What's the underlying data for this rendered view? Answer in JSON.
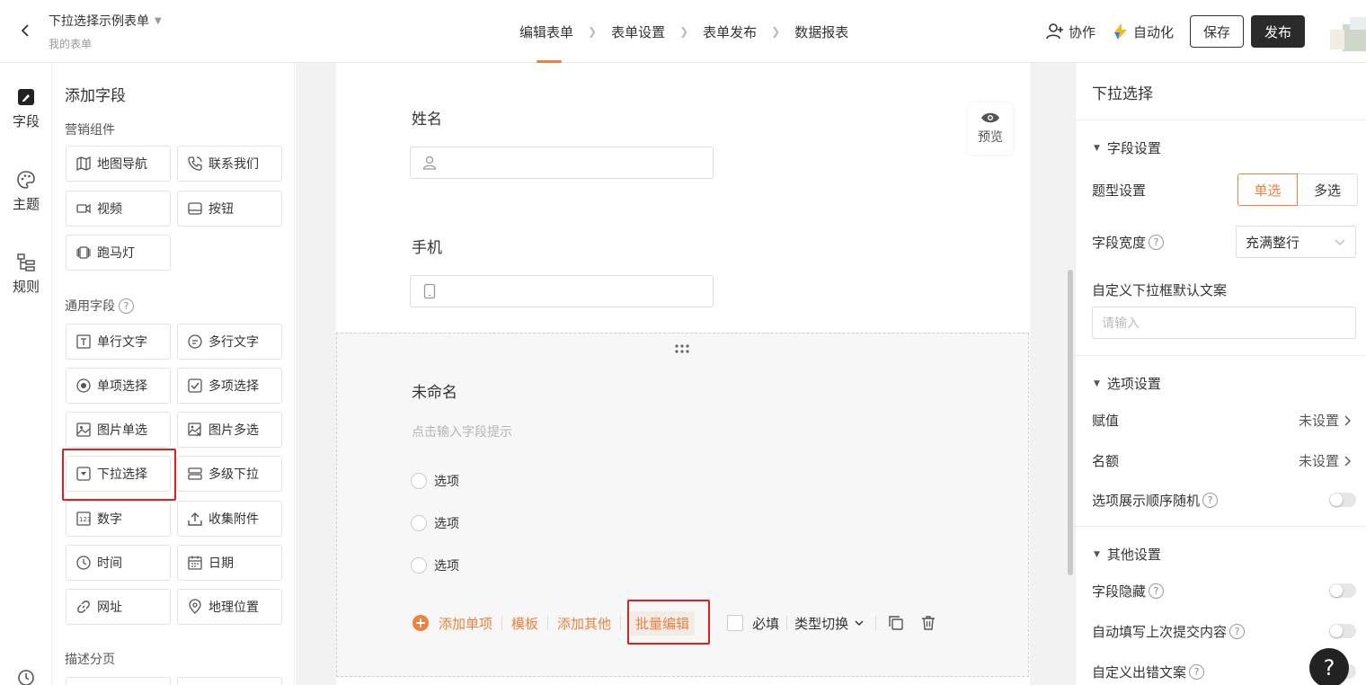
{
  "header": {
    "form_title": "下拉选择示例表单",
    "form_subtitle": "我的表单",
    "steps": [
      "编辑表单",
      "表单设置",
      "表单发布",
      "数据报表"
    ],
    "collab_label": "协作",
    "automation_label": "自动化",
    "save_label": "保存",
    "publish_label": "发布"
  },
  "rail": {
    "fields_label": "字段",
    "theme_label": "主题",
    "rules_label": "规则"
  },
  "palette": {
    "title": "添加字段",
    "marketing_group": "营销组件",
    "marketing_items": [
      "地图导航",
      "联系我们",
      "视频",
      "按钮",
      "跑马灯"
    ],
    "general_group": "通用字段",
    "general_items": [
      "单行文字",
      "多行文字",
      "单项选择",
      "多项选择",
      "图片单选",
      "图片多选",
      "下拉选择",
      "多级下拉",
      "数字",
      "收集附件",
      "时间",
      "日期",
      "网址",
      "地理位置"
    ],
    "desc_group": "描述分页"
  },
  "canvas": {
    "name_label": "姓名",
    "phone_label": "手机",
    "preview_label": "预览",
    "field_label": "未命名",
    "field_hint": "点击输入字段提示",
    "options": [
      "选项",
      "选项",
      "选项"
    ],
    "add_option": "添加单项",
    "template": "模板",
    "add_other": "添加其他",
    "bulk_edit": "批量编辑",
    "required": "必填",
    "type_switch": "类型切换"
  },
  "right_panel": {
    "title": "下拉选择",
    "field_settings": "字段设置",
    "type_label": "题型设置",
    "single": "单选",
    "multi": "多选",
    "width_label": "字段宽度",
    "width_value": "充满整行",
    "custom_default_label": "自定义下拉框默认文案",
    "custom_default_placeholder": "请输入",
    "option_settings": "选项设置",
    "assign_label": "赋值",
    "assign_value": "未设置",
    "quota_label": "名额",
    "quota_value": "未设置",
    "random_label": "选项展示顺序随机",
    "other_settings": "其他设置",
    "hide_label": "字段隐藏",
    "autofill_label": "自动填写上次提交内容",
    "error_label": "自定义出错文案"
  },
  "colors": {
    "accent": "#f27f3d",
    "highlight": "#e0201c",
    "dark": "#2b2b2b"
  }
}
